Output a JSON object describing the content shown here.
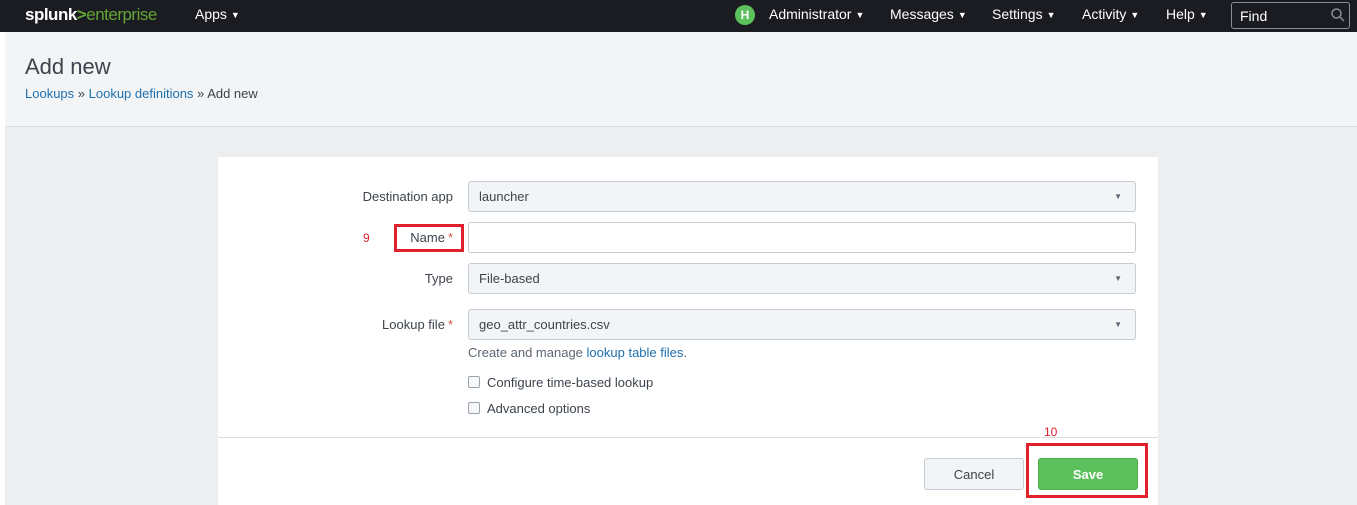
{
  "topbar": {
    "logo": {
      "brand": "splunk",
      "gt": ">",
      "product": "enterprise"
    },
    "apps_label": "Apps",
    "avatar_letter": "H",
    "user_label": "Administrator",
    "messages_label": "Messages",
    "settings_label": "Settings",
    "activity_label": "Activity",
    "help_label": "Help",
    "find_placeholder": "Find",
    "search_icon": "search-icon"
  },
  "header": {
    "title": "Add new",
    "breadcrumb": {
      "lookups": "Lookups",
      "sep1": " » ",
      "lookup_definitions": "Lookup definitions",
      "sep2": " » ",
      "current": "Add new"
    }
  },
  "form": {
    "destination_app": {
      "label": "Destination app",
      "value": "launcher"
    },
    "name": {
      "label": "Name",
      "required_mark": "*",
      "value": ""
    },
    "type": {
      "label": "Type",
      "value": "File-based"
    },
    "lookup_file": {
      "label": "Lookup file",
      "required_mark": "*",
      "value": "geo_attr_countries.csv",
      "help_prefix": "Create and manage ",
      "help_link": "lookup table files",
      "help_suffix": "."
    },
    "checkboxes": {
      "time_based": {
        "label": "Configure time-based lookup",
        "checked": false
      },
      "advanced": {
        "label": "Advanced options",
        "checked": false
      }
    }
  },
  "buttons": {
    "cancel": "Cancel",
    "save": "Save"
  },
  "annotations": {
    "name_step": "9",
    "save_step": "10"
  },
  "colors": {
    "topbar_bg": "#1a1c21",
    "brand_green": "#65a637",
    "save_green": "#5cc05c",
    "link_blue": "#1e6fae",
    "annotation_red": "#e0202b"
  }
}
